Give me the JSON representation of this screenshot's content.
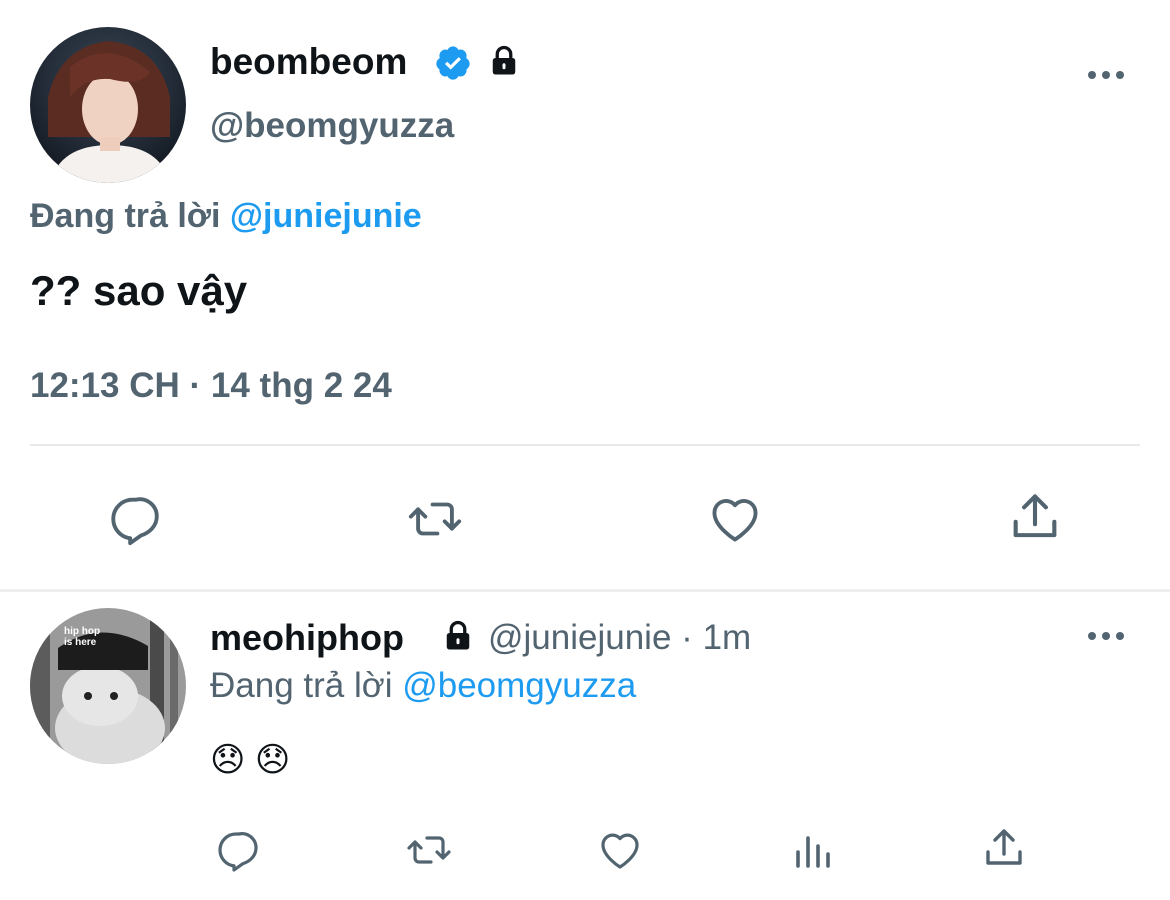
{
  "main_tweet": {
    "display_name": "beombeom",
    "handle": "@beomgyuzza",
    "replying_prefix": "Đang trả lời",
    "replying_to": "@juniejunie",
    "text": "?? sao vậy",
    "timestamp": "12:13 CH · 14 thg 2 24",
    "verified": true,
    "locked": true,
    "actions": [
      "reply-icon",
      "retweet-icon",
      "like-icon",
      "share-icon"
    ]
  },
  "reply_tweet": {
    "display_name": "meohiphop",
    "handle": "@juniejunie",
    "separator": "·",
    "time_ago": "1m",
    "replying_prefix": "Đang trả lời",
    "replying_to": "@beomgyuzza",
    "text": "😞 😞",
    "avatar_text": "hip hop is here",
    "locked": true,
    "actions": [
      "reply-icon",
      "retweet-icon",
      "like-icon",
      "views-icon",
      "share-icon"
    ]
  },
  "colors": {
    "accent": "#1d9bf0",
    "muted": "#536471",
    "text": "#0f1419",
    "divider": "#e7e9eb"
  }
}
